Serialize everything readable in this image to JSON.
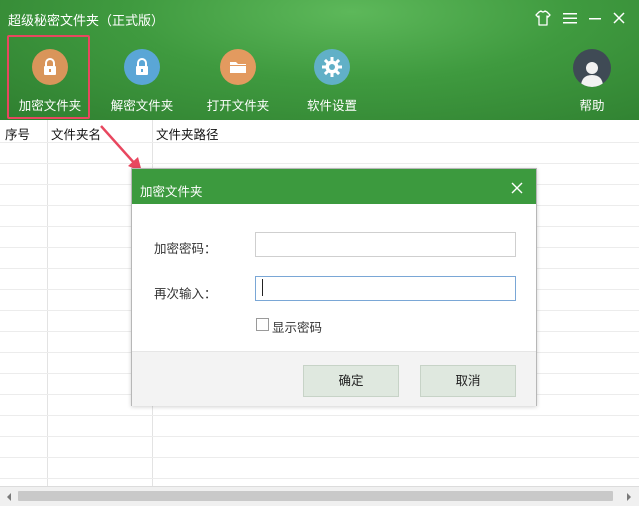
{
  "app": {
    "title": "超级秘密文件夹（正式版）"
  },
  "toolbar": {
    "encrypt_label": "加密文件夹",
    "decrypt_label": "解密文件夹",
    "open_label": "打开文件夹",
    "settings_label": "软件设置",
    "help_label": "帮助"
  },
  "table": {
    "columns": [
      "序号",
      "文件夹名",
      "文件夹路径"
    ]
  },
  "dialog": {
    "title": "加密文件夹",
    "password_label": "加密密码：",
    "password_value": "",
    "confirm_label": "再次输入：",
    "confirm_value": "",
    "show_password_label": "显示密码",
    "show_password_checked": false,
    "ok_label": "确定",
    "cancel_label": "取消"
  },
  "colors": {
    "header_green": "#3f9a3f",
    "dialog_header_green": "#3c9a3e",
    "highlight_red": "#e8475f",
    "lock_orange": "#d9955a",
    "lock_blue": "#5aa6d6"
  }
}
